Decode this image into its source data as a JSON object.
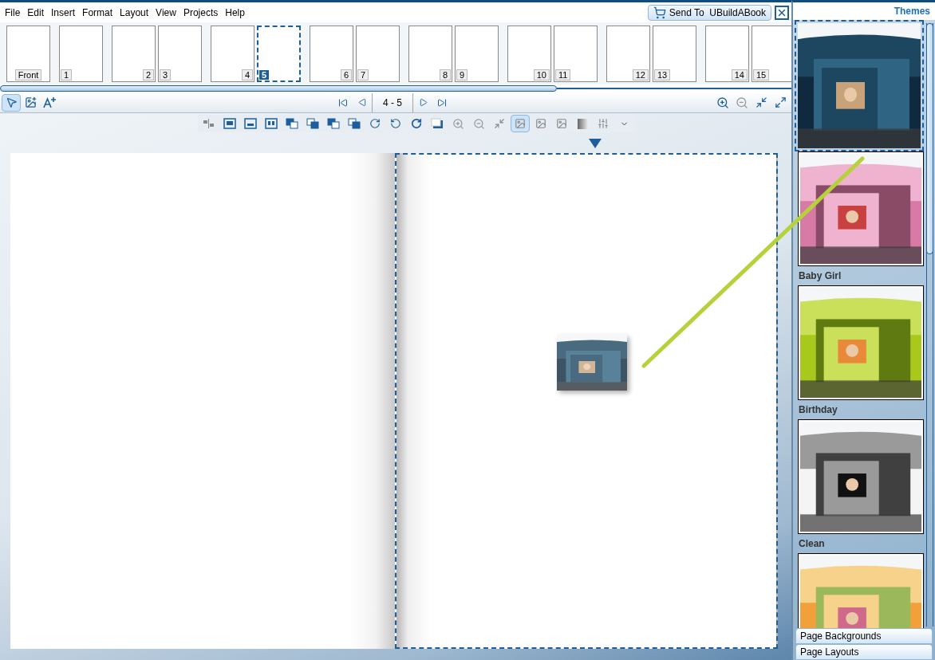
{
  "menu": [
    "File",
    "Edit",
    "Insert",
    "Format",
    "Layout",
    "View",
    "Projects",
    "Help"
  ],
  "send_button": {
    "label": "Send To  UBuildABook"
  },
  "spreads": [
    [
      {
        "label": "Front",
        "kind": "cover",
        "selected": false
      }
    ],
    [
      {
        "label": "1",
        "kind": "right",
        "selected": false
      }
    ],
    [
      {
        "label": "2",
        "kind": "left",
        "selected": false
      },
      {
        "label": "3",
        "kind": "right",
        "selected": false
      }
    ],
    [
      {
        "label": "4",
        "kind": "left",
        "selected": false
      },
      {
        "label": "5",
        "kind": "right",
        "selected": true
      }
    ],
    [
      {
        "label": "6",
        "kind": "left",
        "selected": false
      },
      {
        "label": "7",
        "kind": "right",
        "selected": false
      }
    ],
    [
      {
        "label": "8",
        "kind": "left",
        "selected": false
      },
      {
        "label": "9",
        "kind": "right",
        "selected": false
      }
    ],
    [
      {
        "label": "10",
        "kind": "left",
        "selected": false
      },
      {
        "label": "11",
        "kind": "right",
        "selected": false
      }
    ],
    [
      {
        "label": "12",
        "kind": "left",
        "selected": false
      },
      {
        "label": "13",
        "kind": "right",
        "selected": false
      }
    ],
    [
      {
        "label": "14",
        "kind": "left",
        "selected": false
      },
      {
        "label": "15",
        "kind": "right",
        "selected": false
      }
    ]
  ],
  "tools": [
    {
      "selected": true
    },
    {
      "selected": false
    },
    {
      "selected": false
    }
  ],
  "page_range": "4 - 5",
  "image_modes": [
    {
      "selected": true
    },
    {
      "selected": false
    },
    {
      "selected": false
    }
  ],
  "spread_pages": [
    {
      "selected": false
    },
    {
      "selected": true
    }
  ],
  "themes_panel": {
    "title": "Themes",
    "themes": [
      {
        "selected": true
      },
      {
        "caption": "Baby Girl",
        "selected": false
      },
      {
        "caption": "Birthday",
        "selected": false
      },
      {
        "caption": "Clean",
        "selected": false
      },
      {
        "selected": false
      }
    ]
  },
  "accordion": [
    "Page Backgrounds",
    "Page Layouts"
  ]
}
